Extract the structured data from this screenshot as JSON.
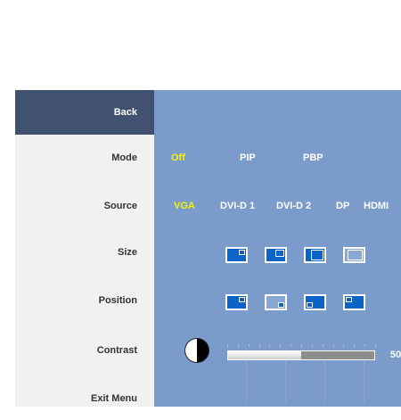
{
  "menu": {
    "back": "Back",
    "mode": "Mode",
    "source": "Source",
    "size": "Size",
    "position": "Position",
    "contrast": "Contrast",
    "exit": "Exit Menu"
  },
  "mode_options": [
    "Off",
    "PIP",
    "PBP"
  ],
  "mode_selected": "Off",
  "source_options": [
    "VGA",
    "DVI-D 1",
    "DVI-D 2",
    "DP",
    "HDMI"
  ],
  "source_selected": "VGA",
  "size_icons": [
    "pip-small-icon",
    "pip-medium-icon",
    "pip-large-icon",
    "pip-empty-icon"
  ],
  "position_icons": [
    "pip-top-right-icon",
    "pip-bottom-right-icon",
    "pip-bottom-left-icon",
    "pip-top-left-icon"
  ],
  "contrast": {
    "value": "50",
    "level": 50,
    "max": 100
  },
  "colors": {
    "panel": "#7b9ccb",
    "highlight": "#40526f",
    "selected": "#f5f500",
    "icon_fill": "#0a64c8"
  }
}
